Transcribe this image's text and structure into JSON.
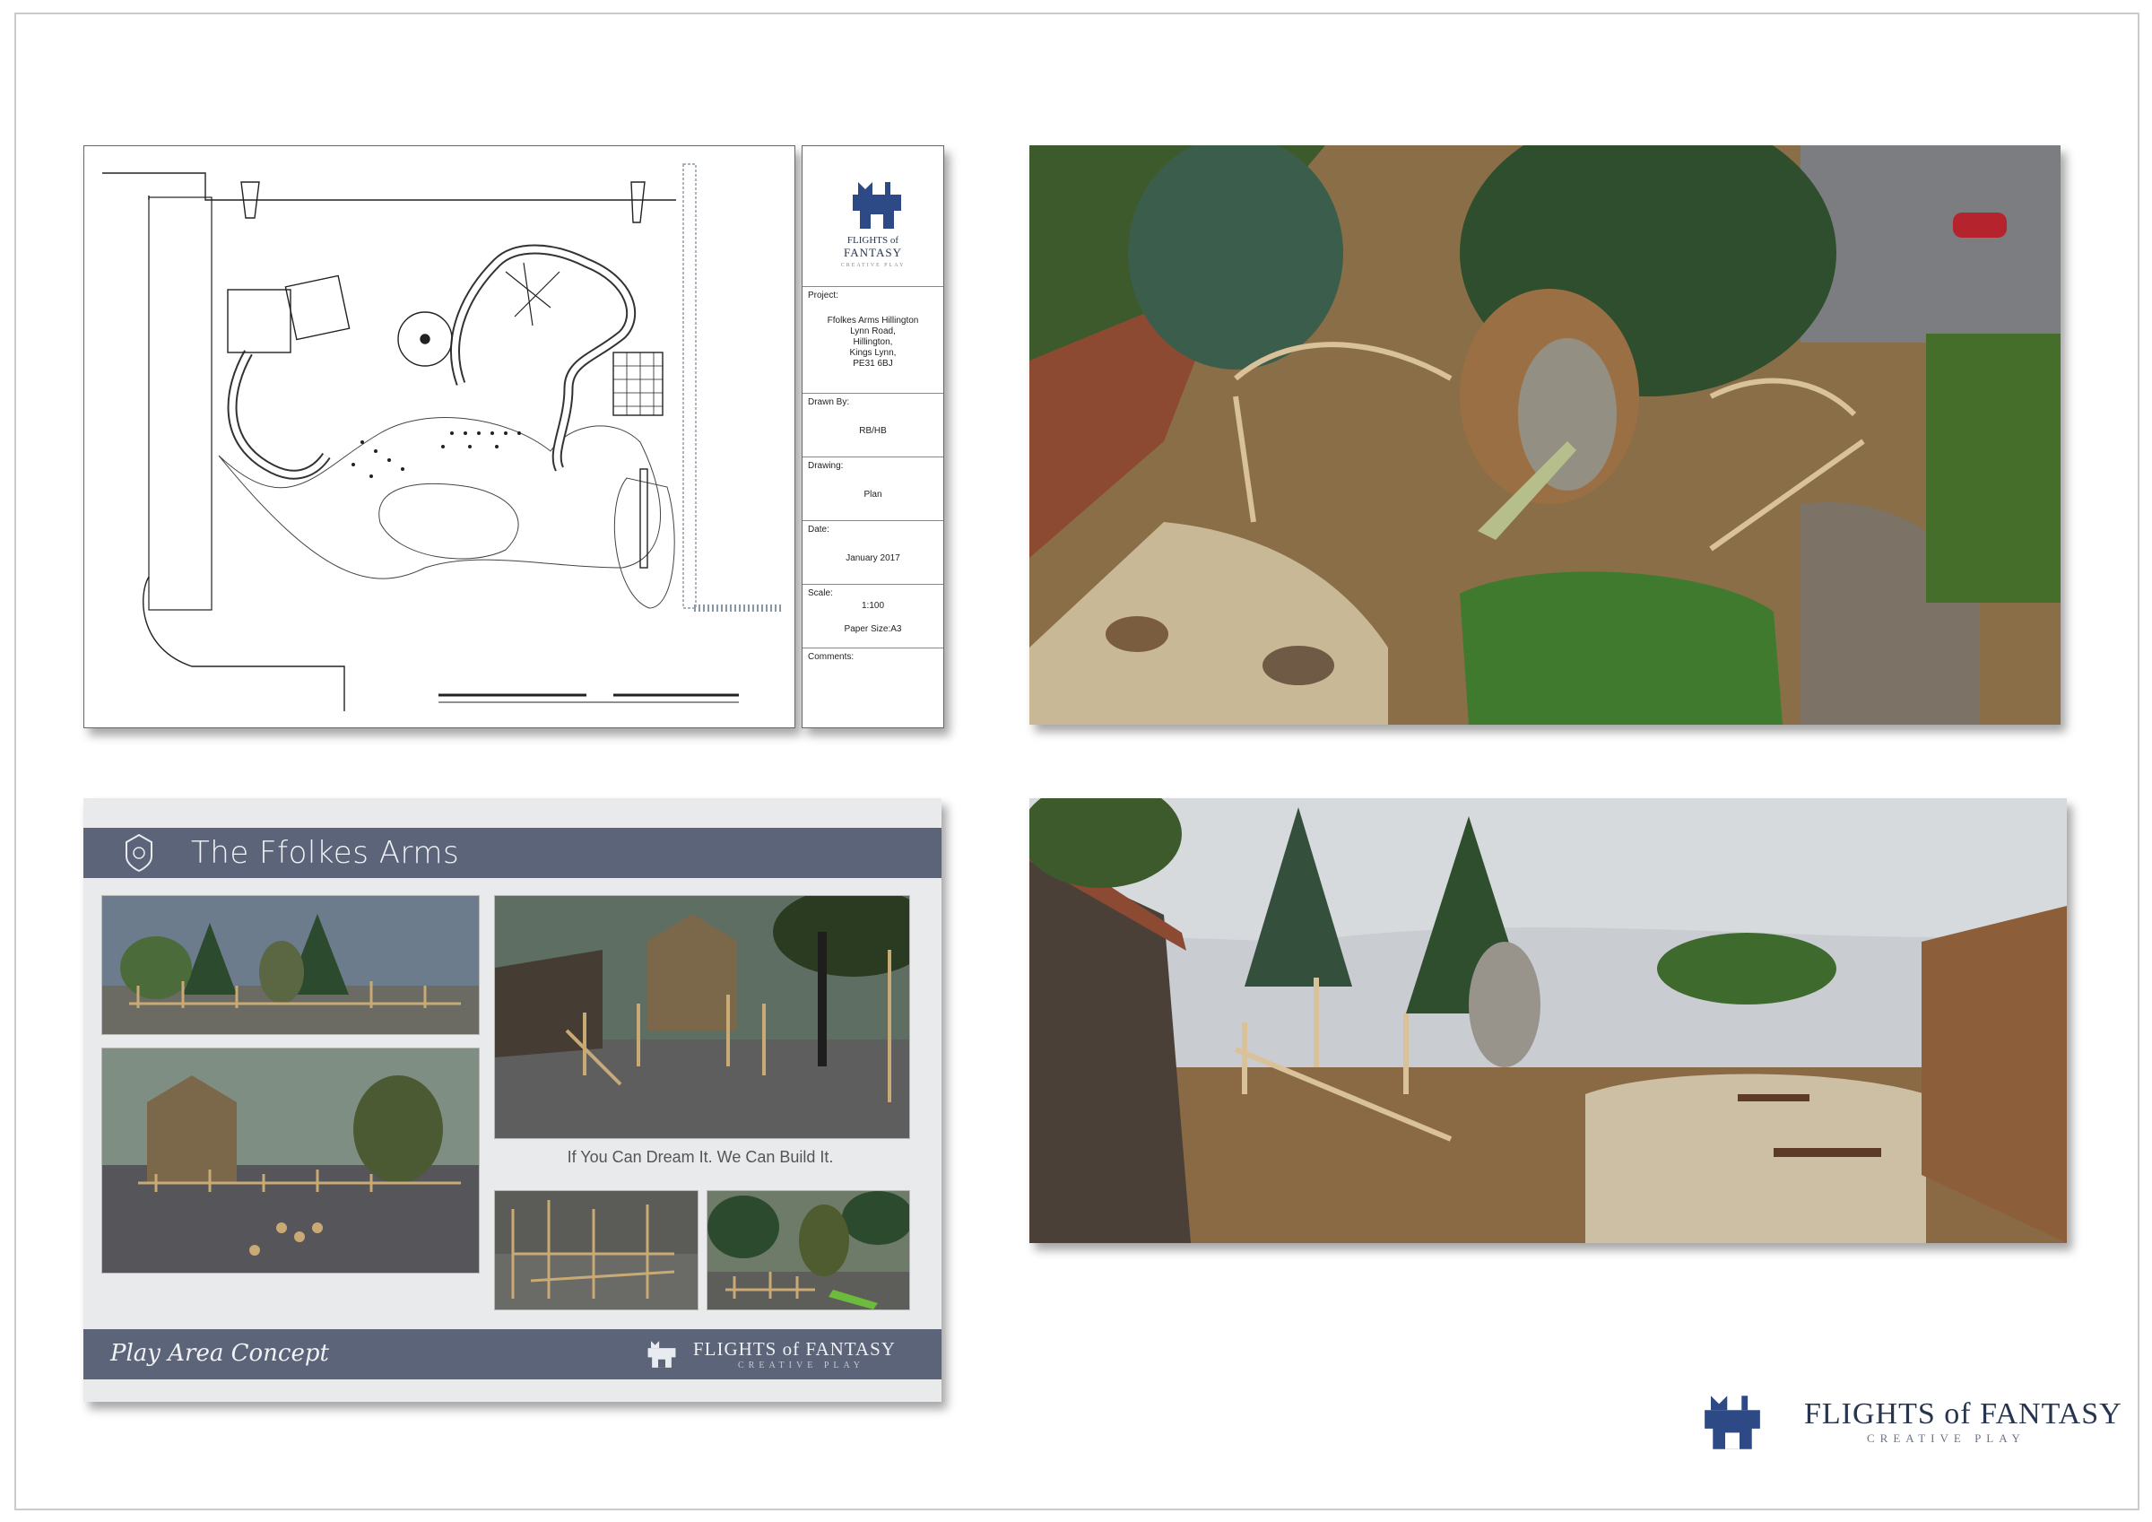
{
  "title_block": {
    "brand_line1": "FLIGHTS of",
    "brand_line2": "FANTASY",
    "brand_tag": "CREATIVE PLAY",
    "project_label": "Project:",
    "project_value": "Ffolkes Arms Hillington\nLynn Road,\nHillington,\nKings Lynn,\nPE31 6BJ",
    "drawn_label": "Drawn By:",
    "drawn_value": "RB/HB",
    "drawing_label": "Drawing:",
    "drawing_value": "Plan",
    "date_label": "Date:",
    "date_value": "January 2017",
    "scale_label": "Scale:",
    "scale_value": "1:100",
    "paper_value": "Paper Size:A3",
    "comments_label": "Comments:"
  },
  "concept": {
    "header_title": "The Ffolkes Arms",
    "tagline": "If You Can Dream It. We Can Build It.",
    "footer_title": "Play Area Concept",
    "footer_brand": "FLIGHTS of FANTASY",
    "footer_brand_sub": "CREATIVE PLAY"
  },
  "footer_brand": {
    "name": "FLIGHTS of FANTASY",
    "sub": "CREATIVE PLAY"
  },
  "colors": {
    "brand_navy": "#27364e",
    "band_slate": "#5b6478",
    "bark_mulch": "#a37b4c",
    "grass": "#3f7a2e",
    "paving": "#cdbfa4"
  }
}
